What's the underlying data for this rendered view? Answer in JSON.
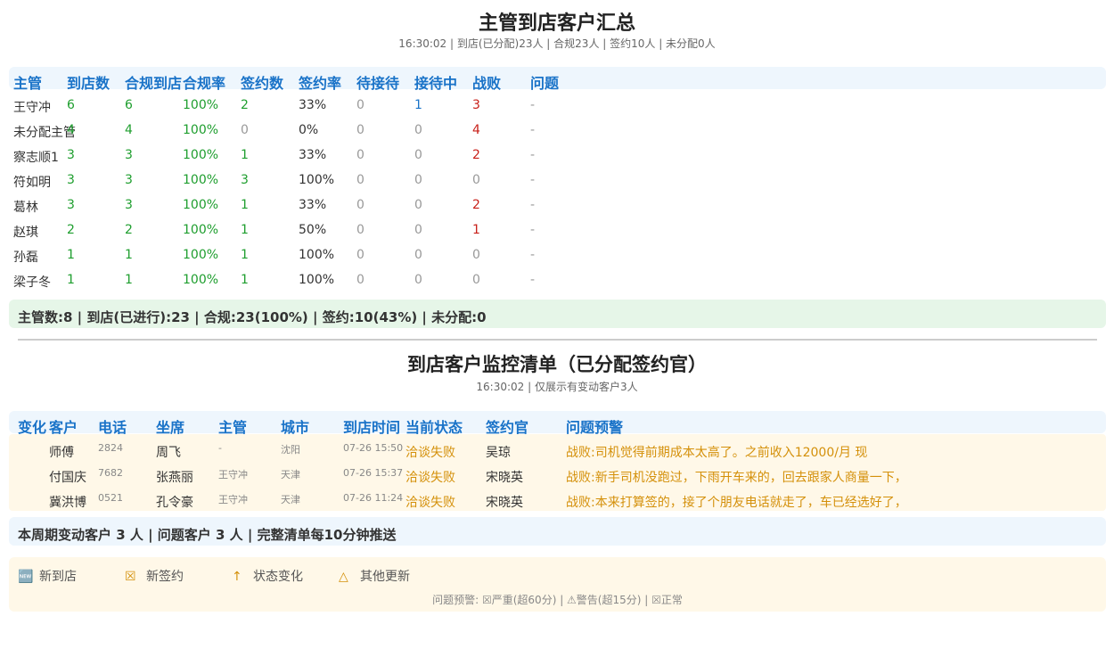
{
  "summary_section": {
    "title": "主管到店客户汇总",
    "subtitle": "16:30:02 | 到店(已分配)23人 | 合规23人 | 签约10人 | 未分配0人",
    "headers": [
      "主管",
      "到店数",
      "合规到店",
      "合规率",
      "签约数",
      "签约率",
      "待接待",
      "接待中",
      "战败",
      "问题"
    ],
    "rows": [
      [
        "王守冲",
        "6",
        "6",
        "100%",
        "2",
        "33%",
        "0",
        "1",
        "3",
        "-"
      ],
      [
        "未分配主管",
        "4",
        "4",
        "100%",
        "0",
        "0%",
        "0",
        "0",
        "4",
        "-"
      ],
      [
        "察志顺1",
        "3",
        "3",
        "100%",
        "1",
        "33%",
        "0",
        "0",
        "2",
        "-"
      ],
      [
        "符如明",
        "3",
        "3",
        "100%",
        "3",
        "100%",
        "0",
        "0",
        "0",
        "-"
      ],
      [
        "葛林",
        "3",
        "3",
        "100%",
        "1",
        "33%",
        "0",
        "0",
        "2",
        "-"
      ],
      [
        "赵琪",
        "2",
        "2",
        "100%",
        "1",
        "50%",
        "0",
        "0",
        "1",
        "-"
      ],
      [
        "孙磊",
        "1",
        "1",
        "100%",
        "1",
        "100%",
        "0",
        "0",
        "0",
        "-"
      ],
      [
        "梁子冬",
        "1",
        "1",
        "100%",
        "1",
        "100%",
        "0",
        "0",
        "0",
        "-"
      ]
    ],
    "totals": "主管数:8 | 到店(已进行):23 | 合规:23(100%) | 签约:10(43%) | 未分配:0",
    "colors": {
      "good": "#1e9e2e",
      "zero": "#999999",
      "active": "#1a73c8",
      "lost": "#c8201a",
      "header": "#1a73c8"
    }
  },
  "monitor_section": {
    "title": "到店客户监控清单（已分配签约官）",
    "subtitle": "16:30:02 | 仅展示有变动客户3人",
    "headers": [
      "变化",
      "客户",
      "电话",
      "坐席",
      "主管",
      "城市",
      "到店时间",
      "当前状态",
      "签约官",
      "问题预警"
    ],
    "rows": [
      [
        "",
        "师傅",
        "2824",
        "周飞",
        "-",
        "沈阳",
        "07-26 15:50",
        "洽谈失败",
        "吴琼",
        "战败:司机觉得前期成本太高了。之前收入12000/月 现"
      ],
      [
        "",
        "付国庆",
        "7682",
        "张燕丽",
        "王守冲",
        "天津",
        "07-26 15:37",
        "洽谈失败",
        "宋晓英",
        "战败:新手司机没跑过，下雨开车来的，回去跟家人商量一下，"
      ],
      [
        "",
        "冀洪博",
        "0521",
        "孔令豪",
        "王守冲",
        "天津",
        "07-26 11:24",
        "洽谈失败",
        "宋晓英",
        "战败:本来打算签的，接了个朋友电话就走了，车已经选好了，"
      ]
    ],
    "footer": "本周期变动客户 3 人 | 问题客户 3 人 | 完整清单每10分钟推送",
    "warning_color": "#d4900a"
  },
  "legend": {
    "items": [
      {
        "icon": "new-icon",
        "glyph": "🆕",
        "label": "新到店"
      },
      {
        "icon": "sign-icon",
        "glyph": "☒",
        "label": "新签约"
      },
      {
        "icon": "arrow-up-icon",
        "glyph": "↑",
        "label": "状态变化"
      },
      {
        "icon": "triangle-icon",
        "glyph": "△",
        "label": "其他更新"
      }
    ],
    "note": "问题预警: ☒严重(超60分) | ⚠警告(超15分) | ☒正常"
  }
}
